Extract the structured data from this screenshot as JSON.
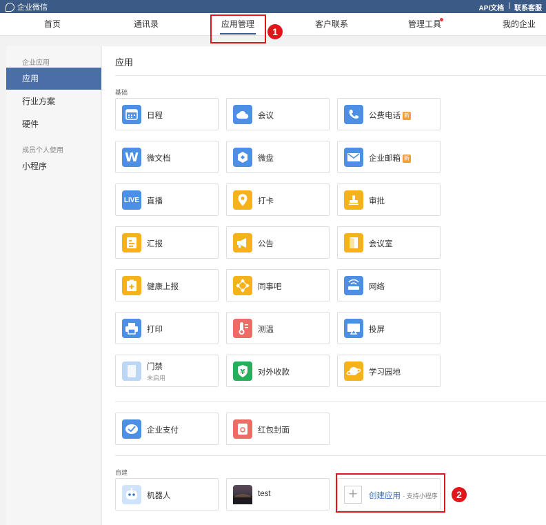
{
  "topbar": {
    "brand": "企业微信",
    "api_docs": "API文档",
    "separator": "|",
    "support": "联系客服"
  },
  "nav": {
    "items": [
      {
        "label": "首页"
      },
      {
        "label": "通讯录"
      },
      {
        "label": "应用管理",
        "active": true
      },
      {
        "label": "客户联系"
      },
      {
        "label": "管理工具",
        "dot": true
      },
      {
        "label": "我的企业"
      }
    ]
  },
  "annotations": {
    "first": "1",
    "second": "2",
    "color": "#e0161a"
  },
  "sidebar": {
    "group1": "企业应用",
    "items1": [
      "应用",
      "行业方案",
      "硬件"
    ],
    "group2": "成员个人使用",
    "items2": [
      "小程序"
    ]
  },
  "main": {
    "title": "应用",
    "section_basic": "基础",
    "section_custom": "自建",
    "tag_text": "新",
    "apps": [
      {
        "label": "日程",
        "icon": "calendar-icon",
        "color": "#4e8fe6"
      },
      {
        "label": "会议",
        "icon": "cloud-icon",
        "color": "#4e8fe6"
      },
      {
        "label": "公费电话",
        "icon": "phone-icon",
        "color": "#4e8fe6",
        "tag": true
      },
      {
        "label": "微文档",
        "icon": "doc-w-icon",
        "color": "#4e8fe6"
      },
      {
        "label": "微盘",
        "icon": "drive-icon",
        "color": "#4e8fe6"
      },
      {
        "label": "企业邮箱",
        "icon": "mail-icon",
        "color": "#4e8fe6",
        "tag": true
      },
      {
        "label": "直播",
        "icon": "live-icon",
        "color": "#4e8fe6"
      },
      {
        "label": "打卡",
        "icon": "location-pin-icon",
        "color": "#f5b21a"
      },
      {
        "label": "审批",
        "icon": "stamp-icon",
        "color": "#f5b21a"
      },
      {
        "label": "汇报",
        "icon": "report-icon",
        "color": "#f5b21a"
      },
      {
        "label": "公告",
        "icon": "megaphone-icon",
        "color": "#f5b21a"
      },
      {
        "label": "会议室",
        "icon": "door-icon",
        "color": "#f5b21a"
      },
      {
        "label": "健康上报",
        "icon": "health-icon",
        "color": "#f5b21a"
      },
      {
        "label": "同事吧",
        "icon": "network-icon",
        "color": "#f5b21a"
      },
      {
        "label": "网络",
        "icon": "router-icon",
        "color": "#4e8fe6"
      },
      {
        "label": "打印",
        "icon": "printer-icon",
        "color": "#4e8fe6"
      },
      {
        "label": "测温",
        "icon": "thermometer-icon",
        "color": "#ef6b65"
      },
      {
        "label": "投屏",
        "icon": "screen-cast-icon",
        "color": "#4e8fe6"
      },
      {
        "label": "门禁",
        "sub": "未启用",
        "icon": "gate-icon",
        "color": "#bcd6f6"
      },
      {
        "label": "对外收款",
        "icon": "yuan-shield-icon",
        "color": "#24b05a"
      },
      {
        "label": "学习园地",
        "icon": "planet-icon",
        "color": "#f5b21a"
      }
    ],
    "apps2": [
      {
        "label": "企业支付",
        "icon": "pay-icon",
        "color": "#4e8fe6"
      },
      {
        "label": "红包封面",
        "icon": "red-envelope-icon",
        "color": "#ef6b65"
      }
    ],
    "custom": [
      {
        "label": "机器人",
        "icon": "robot-icon"
      },
      {
        "label": "test",
        "icon": "thumbnail-image"
      }
    ],
    "create": {
      "label": "创建应用",
      "sub": "· 支持小程序",
      "plus": "+"
    }
  }
}
